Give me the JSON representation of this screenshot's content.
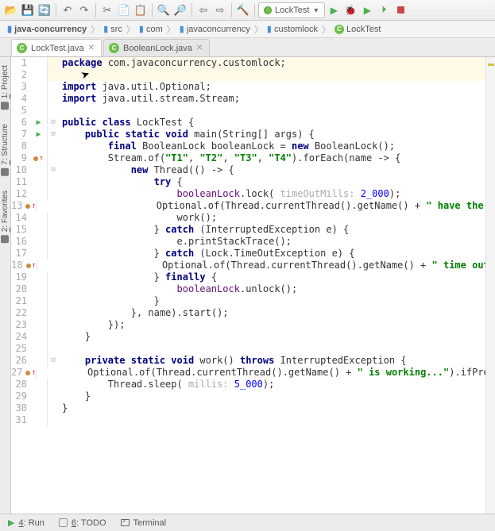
{
  "run_config": {
    "label": "LockTest"
  },
  "breadcrumb": [
    {
      "kind": "project",
      "label": "java-concurrency"
    },
    {
      "kind": "dir",
      "label": "src"
    },
    {
      "kind": "dir",
      "label": "com"
    },
    {
      "kind": "dir",
      "label": "javaconcurrency"
    },
    {
      "kind": "dir",
      "label": "customlock"
    },
    {
      "kind": "class",
      "label": "LockTest"
    }
  ],
  "editor_tabs": [
    {
      "label": "LockTest.java",
      "active": true,
      "icon": "class"
    },
    {
      "label": "BooleanLock.java",
      "active": false,
      "icon": "class"
    }
  ],
  "left_tool_windows": [
    {
      "index": "1",
      "label": "Project"
    },
    {
      "index": "7",
      "label": "Structure"
    },
    {
      "index": "2",
      "label": "Favorites"
    }
  ],
  "bottom_tool_windows": [
    {
      "index": "4",
      "label": "Run",
      "icon": "play"
    },
    {
      "index": "6",
      "label": "TODO",
      "icon": "todo"
    },
    {
      "index": "",
      "label": "Terminal",
      "icon": "terminal"
    }
  ],
  "toolbar_icons": [
    "open-icon",
    "save-all-icon",
    "refresh-icon",
    "sep",
    "undo-icon",
    "redo-icon",
    "sep",
    "cut-icon",
    "copy-icon",
    "paste-icon",
    "sep",
    "find-icon",
    "replace-icon",
    "sep",
    "back-icon",
    "forward-icon",
    "sep",
    "build-icon",
    "sep"
  ],
  "code_lines": [
    {
      "n": 1,
      "gut": "",
      "fold": "",
      "hl": true,
      "seg": [
        [
          "kw",
          "package"
        ],
        [
          "",
          " com.javaconcurrency.customlock;"
        ]
      ]
    },
    {
      "n": 2,
      "gut": "",
      "fold": "",
      "hl": true,
      "seg": []
    },
    {
      "n": 3,
      "gut": "",
      "fold": "",
      "seg": [
        [
          "kw",
          "import"
        ],
        [
          "",
          " java.util.Optional;"
        ]
      ]
    },
    {
      "n": 4,
      "gut": "",
      "fold": "",
      "seg": [
        [
          "kw",
          "import"
        ],
        [
          "",
          " java.util.stream.Stream;"
        ]
      ]
    },
    {
      "n": 5,
      "gut": "",
      "fold": "",
      "seg": []
    },
    {
      "n": 6,
      "gut": "run",
      "fold": "open",
      "seg": [
        [
          "kw",
          "public class"
        ],
        [
          "",
          " LockTest {"
        ]
      ]
    },
    {
      "n": 7,
      "gut": "run",
      "fold": "open",
      "seg": [
        [
          "",
          "    "
        ],
        [
          "kw",
          "public static void"
        ],
        [
          "",
          " main(String[] args) {"
        ]
      ]
    },
    {
      "n": 8,
      "gut": "",
      "fold": "",
      "seg": [
        [
          "",
          "        "
        ],
        [
          "kw",
          "final"
        ],
        [
          "",
          " BooleanLock booleanLock = "
        ],
        [
          "kw",
          "new"
        ],
        [
          "",
          " BooleanLock();"
        ]
      ]
    },
    {
      "n": 9,
      "gut": "impl",
      "fold": "",
      "seg": [
        [
          "",
          "        Stream."
        ],
        [
          "",
          "of("
        ],
        [
          "str",
          "\"T1\""
        ],
        [
          "",
          ", "
        ],
        [
          "str",
          "\"T2\""
        ],
        [
          "",
          ", "
        ],
        [
          "str",
          "\"T3\""
        ],
        [
          "",
          ", "
        ],
        [
          "str",
          "\"T4\""
        ],
        [
          "",
          ").forEach(name -> {"
        ]
      ]
    },
    {
      "n": 10,
      "gut": "",
      "fold": "open",
      "seg": [
        [
          "",
          "            "
        ],
        [
          "kw",
          "new"
        ],
        [
          "",
          " Thread(() -> {"
        ]
      ]
    },
    {
      "n": 11,
      "gut": "",
      "fold": "",
      "seg": [
        [
          "",
          "                "
        ],
        [
          "kw",
          "try"
        ],
        [
          "",
          " {"
        ]
      ]
    },
    {
      "n": 12,
      "gut": "",
      "fold": "",
      "seg": [
        [
          "",
          "                    "
        ],
        [
          "fld",
          "booleanLock"
        ],
        [
          "",
          ".lock( "
        ],
        [
          "hint",
          "timeOutMills: "
        ],
        [
          "num",
          "2_000"
        ],
        [
          "",
          ");"
        ]
      ]
    },
    {
      "n": 13,
      "gut": "impl",
      "fold": "",
      "seg": [
        [
          "",
          "                    Optional."
        ],
        [
          "",
          "of(Thread."
        ],
        [
          "",
          "currentThread().getName() + "
        ],
        [
          "str",
          "\" have the l"
        ]
      ]
    },
    {
      "n": 14,
      "gut": "",
      "fold": "",
      "seg": [
        [
          "",
          "                    work();"
        ]
      ]
    },
    {
      "n": 15,
      "gut": "",
      "fold": "",
      "seg": [
        [
          "",
          "                } "
        ],
        [
          "kw",
          "catch"
        ],
        [
          "",
          " (InterruptedException e) {"
        ]
      ]
    },
    {
      "n": 16,
      "gut": "",
      "fold": "",
      "seg": [
        [
          "",
          "                    e.printStackTrace();"
        ]
      ]
    },
    {
      "n": 17,
      "gut": "",
      "fold": "",
      "seg": [
        [
          "",
          "                } "
        ],
        [
          "kw",
          "catch"
        ],
        [
          "",
          " (Lock.TimeOutException e) {"
        ]
      ]
    },
    {
      "n": 18,
      "gut": "impl",
      "fold": "",
      "seg": [
        [
          "",
          "                    Optional."
        ],
        [
          "",
          "of(Thread."
        ],
        [
          "",
          "currentThread().getName() + "
        ],
        [
          "str",
          "\" time out\""
        ]
      ]
    },
    {
      "n": 19,
      "gut": "",
      "fold": "",
      "seg": [
        [
          "",
          "                } "
        ],
        [
          "kw",
          "finally"
        ],
        [
          "",
          " {"
        ]
      ]
    },
    {
      "n": 20,
      "gut": "",
      "fold": "",
      "seg": [
        [
          "",
          "                    "
        ],
        [
          "fld",
          "booleanLock"
        ],
        [
          "",
          ".unlock();"
        ]
      ]
    },
    {
      "n": 21,
      "gut": "",
      "fold": "",
      "seg": [
        [
          "",
          "                }"
        ]
      ]
    },
    {
      "n": 22,
      "gut": "",
      "fold": "",
      "seg": [
        [
          "",
          "            }, name).start();"
        ]
      ]
    },
    {
      "n": 23,
      "gut": "",
      "fold": "",
      "seg": [
        [
          "",
          "        });"
        ]
      ]
    },
    {
      "n": 24,
      "gut": "",
      "fold": "",
      "seg": [
        [
          "",
          "    }"
        ]
      ]
    },
    {
      "n": 25,
      "gut": "",
      "fold": "",
      "seg": []
    },
    {
      "n": 26,
      "gut": "",
      "fold": "open",
      "seg": [
        [
          "",
          "    "
        ],
        [
          "kw",
          "private static void"
        ],
        [
          "",
          " work() "
        ],
        [
          "kw",
          "throws"
        ],
        [
          "",
          " InterruptedException {"
        ]
      ]
    },
    {
      "n": 27,
      "gut": "impl",
      "fold": "",
      "seg": [
        [
          "",
          "        Optional."
        ],
        [
          "",
          "of(Thread."
        ],
        [
          "",
          "currentThread().getName() + "
        ],
        [
          "str",
          "\" is working...\""
        ],
        [
          "",
          ").ifPres"
        ]
      ]
    },
    {
      "n": 28,
      "gut": "",
      "fold": "",
      "seg": [
        [
          "",
          "        Thread."
        ],
        [
          "",
          "sleep( "
        ],
        [
          "hint",
          "millis: "
        ],
        [
          "num",
          "5_000"
        ],
        [
          "",
          ");"
        ]
      ]
    },
    {
      "n": 29,
      "gut": "",
      "fold": "",
      "seg": [
        [
          "",
          "    }"
        ]
      ]
    },
    {
      "n": 30,
      "gut": "",
      "fold": "",
      "seg": [
        [
          "",
          "}"
        ]
      ]
    },
    {
      "n": 31,
      "gut": "",
      "fold": "",
      "seg": []
    }
  ]
}
